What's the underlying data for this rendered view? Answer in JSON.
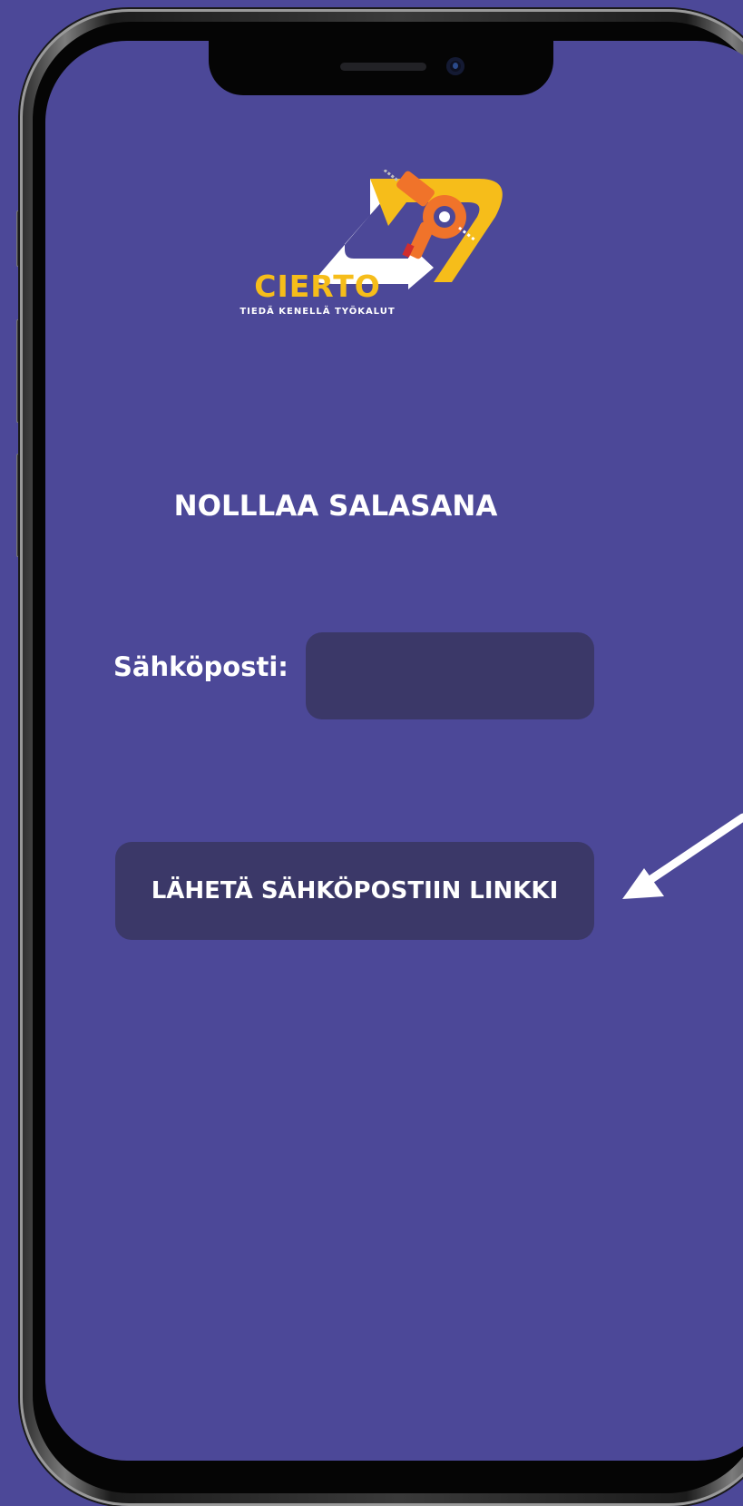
{
  "logo": {
    "name": "CIERTO",
    "tagline": "TIEDÄ KENELLÄ TYÖKALUT",
    "colors": {
      "yellow": "#f6bd1a",
      "white": "#ffffff",
      "orange": "#f0732a"
    },
    "icon": "drill-logo-icon"
  },
  "page": {
    "title": "NOLLLAA SALASANA"
  },
  "form": {
    "email_label": "Sähköposti:",
    "email_value": "",
    "submit_label": "LÄHETÄ SÄHKÖPOSTIIN LINKKI"
  },
  "annotation": {
    "icon": "arrow-pointer-icon",
    "color": "#ffffff"
  },
  "colors": {
    "background": "#4c4898",
    "field": "#3b3868",
    "text": "#ffffff"
  }
}
